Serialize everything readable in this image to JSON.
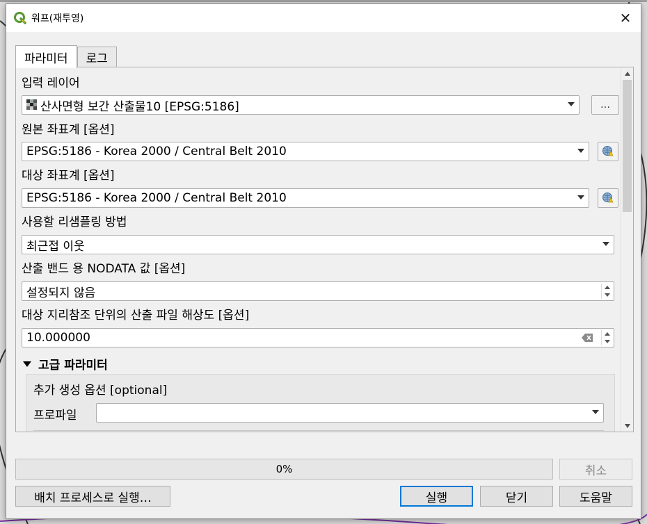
{
  "window": {
    "title": "워프(재투영)",
    "close_label": "✕"
  },
  "tabs": [
    {
      "label": "파라미터",
      "active": true
    },
    {
      "label": "로그",
      "active": false
    }
  ],
  "params": {
    "input_layer": {
      "label": "입력 레이어",
      "value": "산사면형 보간 산출물10 [EPSG:5186]",
      "browse_label": "…"
    },
    "source_crs": {
      "label": "원본 좌표계 [옵션]",
      "value": "EPSG:5186 - Korea 2000 / Central Belt 2010"
    },
    "target_crs": {
      "label": "대상 좌표계 [옵션]",
      "value": "EPSG:5186 - Korea 2000 / Central Belt 2010"
    },
    "resampling": {
      "label": "사용할 리샘플링 방법",
      "value": "최근접 이웃"
    },
    "nodata": {
      "label": "산출 밴드 용 NODATA 값 [옵션]",
      "value": "설정되지 않음"
    },
    "resolution": {
      "label": "대상 지리참조 단위의 산출 파일 해상도 [옵션]",
      "value": "10.000000"
    },
    "advanced": {
      "header": "고급 파라미터",
      "extra_options_label": "추가 생성 옵션 [optional]",
      "profile_label": "프로파일",
      "profile_value": ""
    }
  },
  "progress": {
    "text": "0%",
    "value": 0
  },
  "buttons": {
    "cancel": "취소",
    "batch": "배치 프로세스로 실행…",
    "run": "실행",
    "close": "닫기",
    "help": "도움말"
  },
  "colors": {
    "accent": "#0078d7",
    "qgis_green": "#589632",
    "qgis_yellow": "#f0c419"
  }
}
